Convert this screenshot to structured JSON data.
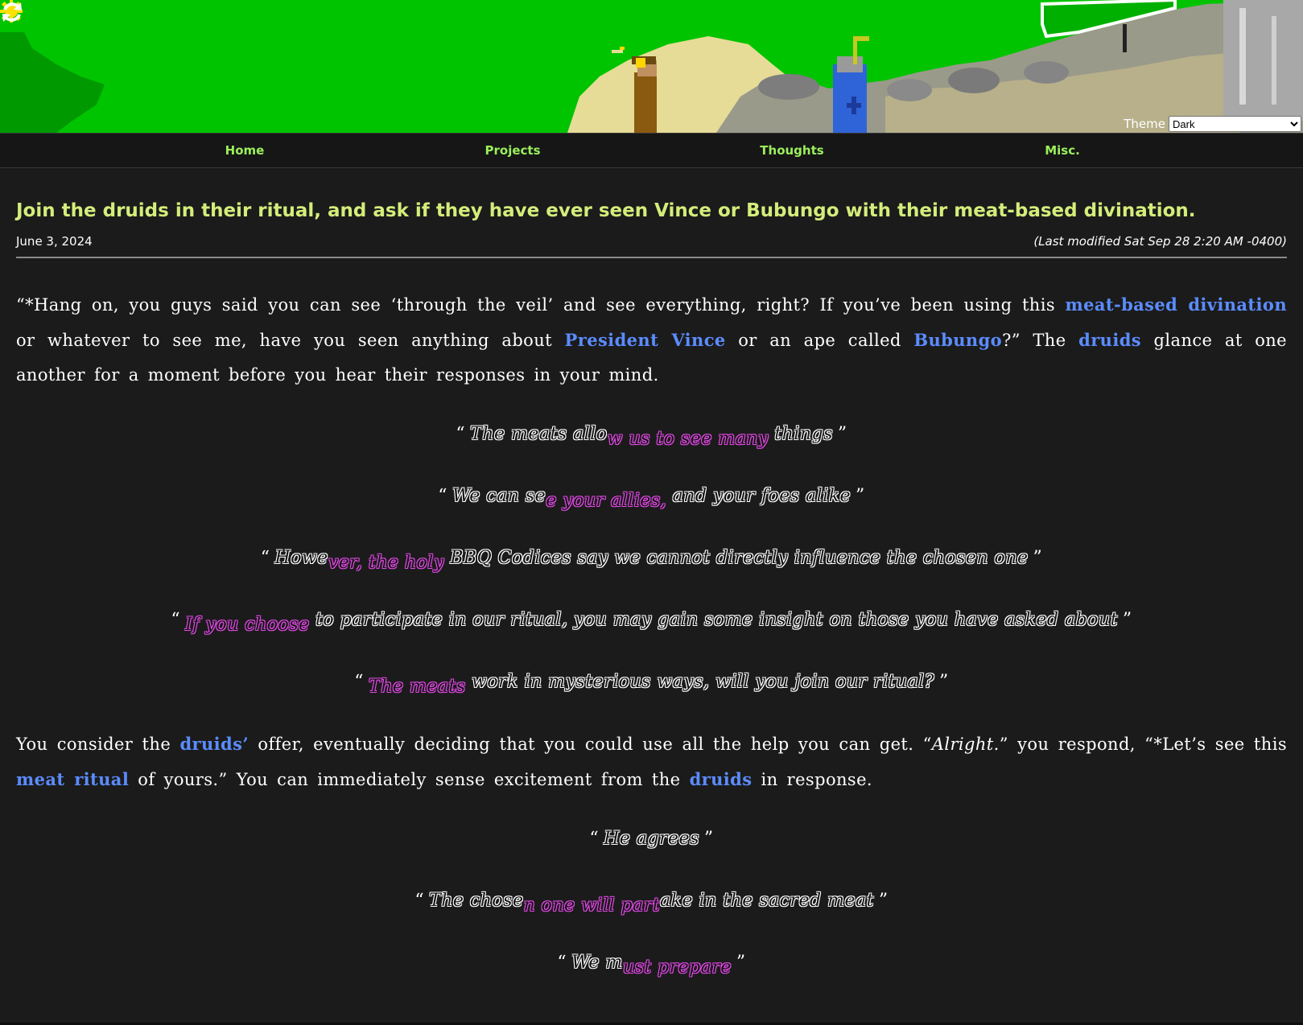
{
  "header": {
    "theme_label": "Theme",
    "theme_value": "Dark",
    "theme_options": [
      "Dark"
    ]
  },
  "nav": {
    "home": "Home",
    "projects": "Projects",
    "thoughts": "Thoughts",
    "misc": "Misc."
  },
  "post": {
    "title": "Join the druids in their ritual, and ask if they have ever seen Vince or Bubungo with their meat-based divination.",
    "date": "June 3, 2024",
    "modified": "(Last modified Sat Sep 28 2:20 AM -0400)",
    "p1": {
      "t1": "“*Hang on, you guys said you can see ‘through the veil’ and see everything, right? If you’ve been using this ",
      "l1": "meat-based divination",
      "t2": " or whatever to see me, have you seen anything about ",
      "l2": "President Vince",
      "t3": " or an ape called ",
      "l3": "Bubungo",
      "t4": "?” The ",
      "l4": "druids",
      "t5": " glance at one another for a moment before you hear their responses in your mind."
    },
    "quotes1": [
      {
        "a": "The meats allo",
        "b": "w us to see many",
        "c": " things"
      },
      {
        "a": "We can se",
        "b": "e your allies,",
        "c": " and your foes alike"
      },
      {
        "a": "Howe",
        "b": "ver, the holy",
        "c": " BBQ Codices say we cannot directly influence the chosen one"
      },
      {
        "a": "",
        "b": "If you choose",
        "c": " to participate in our ritual, you may gain some insight on those you have asked about"
      },
      {
        "a": "",
        "b": "The meats",
        "c": " work in mysterious ways, will you join our ritual?"
      }
    ],
    "p2": {
      "t1": "You consider the ",
      "l1": "druids’",
      "t2": " offer, eventually deciding that you could use all the help you can get. “",
      "i1": "Alright.",
      "t3": "” you respond, “*Let’s see this ",
      "l2": "meat ritual",
      "t4": " of yours.” You can immediately sense excitement from the ",
      "l3": "druids",
      "t5": " in response."
    },
    "quotes2": [
      {
        "a": "He agrees",
        "b": "",
        "c": ""
      },
      {
        "a": "The chose",
        "b": "n one will part",
        "c": "ake in the sacred meat"
      },
      {
        "a": "We m",
        "b": "ust prepare",
        "c": ""
      }
    ],
    "open_quote": "“",
    "close_quote": "”"
  },
  "colors": {
    "sky": "#00c400",
    "nav_link": "#9bef5b",
    "title": "#d4ed7a",
    "link": "#5b8cff",
    "glow": "#e24ae6"
  },
  "icons": [
    "sun-icon",
    "refresh-icon"
  ]
}
